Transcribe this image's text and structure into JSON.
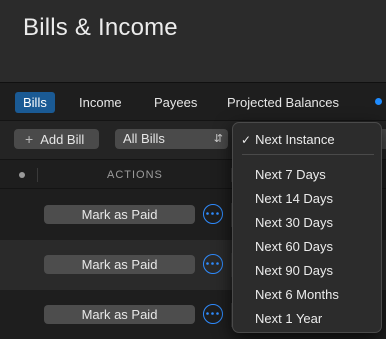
{
  "header": {
    "title": "Bills & Income"
  },
  "tabs": [
    {
      "label": "Bills",
      "active": true
    },
    {
      "label": "Income",
      "active": false
    },
    {
      "label": "Payees",
      "active": false
    },
    {
      "label": "Projected Balances",
      "active": false
    }
  ],
  "toolbar": {
    "add_label": "Add Bill",
    "filter_value": "All Bills"
  },
  "table": {
    "actions_header": "ACTIONS"
  },
  "rows": [
    {
      "action_label": "Mark as Paid"
    },
    {
      "action_label": "Mark as Paid"
    },
    {
      "action_label": "Mark as Paid"
    }
  ],
  "period_menu": {
    "selected": "Next Instance",
    "options": [
      "Next 7 Days",
      "Next 14 Days",
      "Next 30 Days",
      "Next 60 Days",
      "Next 90 Days",
      "Next 6 Months",
      "Next 1 Year"
    ]
  },
  "colors": {
    "accent": "#1a5a94",
    "link_blue": "#2f8cff",
    "background": "#1e1e1e"
  },
  "icons": {
    "add": "plus-icon",
    "select": "chevron-updown-icon",
    "more": "ellipsis-circle-icon",
    "check": "checkmark-icon"
  }
}
